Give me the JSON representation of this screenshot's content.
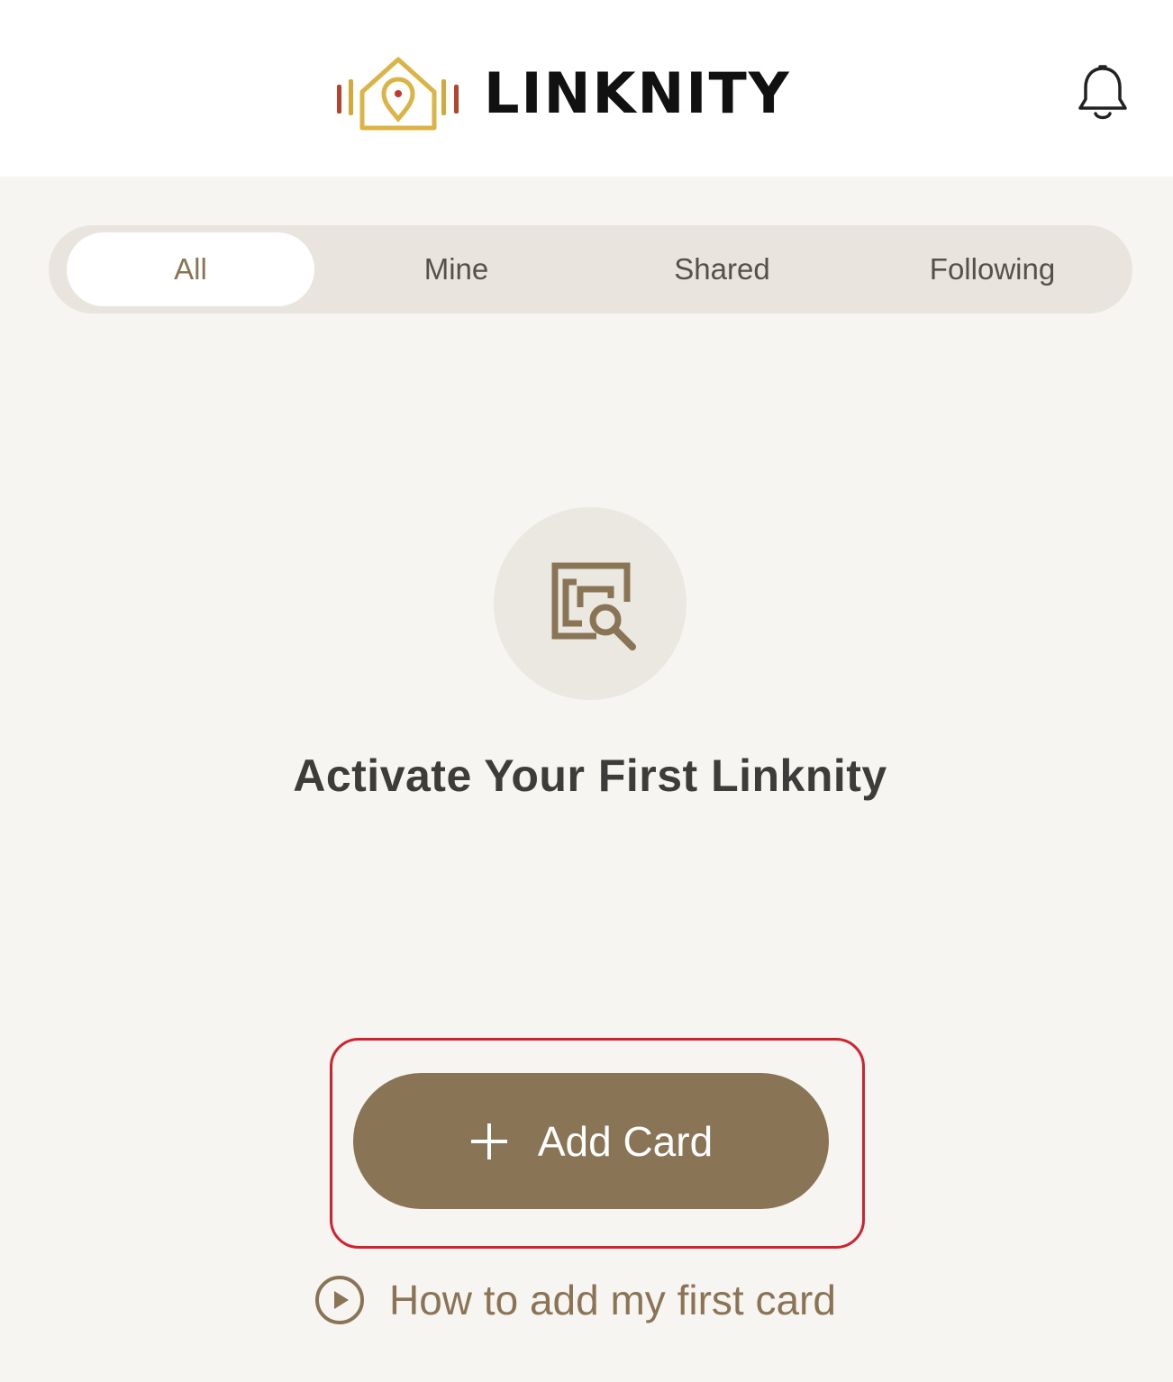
{
  "header": {
    "brand": "LINKNITY",
    "notification_icon": "bell-icon"
  },
  "tabs": [
    {
      "label": "All",
      "active": true
    },
    {
      "label": "Mine",
      "active": false
    },
    {
      "label": "Shared",
      "active": false
    },
    {
      "label": "Following",
      "active": false
    }
  ],
  "empty_state": {
    "icon": "card-search-icon",
    "title": "Activate Your First Linknity"
  },
  "actions": {
    "add_card_label": "Add Card",
    "add_card_icon": "plus-icon",
    "howto_label": "How to add my first card",
    "howto_icon": "play-circle-icon"
  },
  "colors": {
    "accent": "#8a7456",
    "background": "#f7f5f2",
    "tab_track": "#e9e4de",
    "highlight": "#d0222f"
  }
}
